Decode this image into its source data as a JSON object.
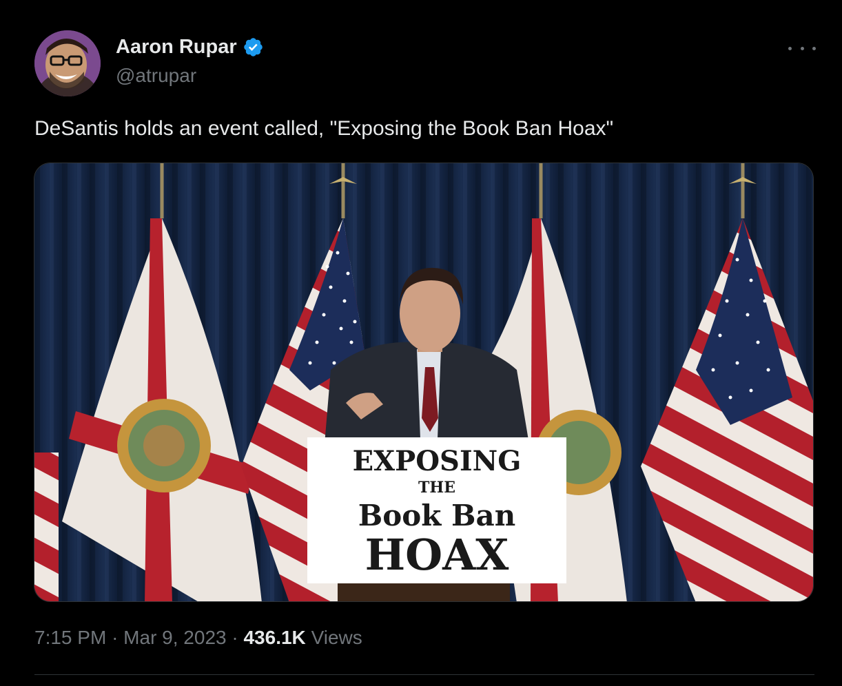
{
  "author": {
    "name": "Aaron Rupar",
    "handle": "@atrupar",
    "verified": true,
    "verified_color": "#1d9bf0"
  },
  "tweet": {
    "text": "DeSantis holds an event called, \"Exposing the Book Ban Hoax\""
  },
  "media": {
    "sign_line1": "EXPOSING",
    "sign_line2": "THE",
    "sign_line3": "Book Ban",
    "sign_line4": "HOAX"
  },
  "meta": {
    "time": "7:15 PM",
    "sep1": "·",
    "date": "Mar 9, 2023",
    "sep2": "·",
    "views_count": "436.1K",
    "views_label": "Views"
  },
  "colors": {
    "background": "#000000",
    "text": "#e7e9ea",
    "secondary": "#71767b",
    "divider": "#2f3336"
  }
}
